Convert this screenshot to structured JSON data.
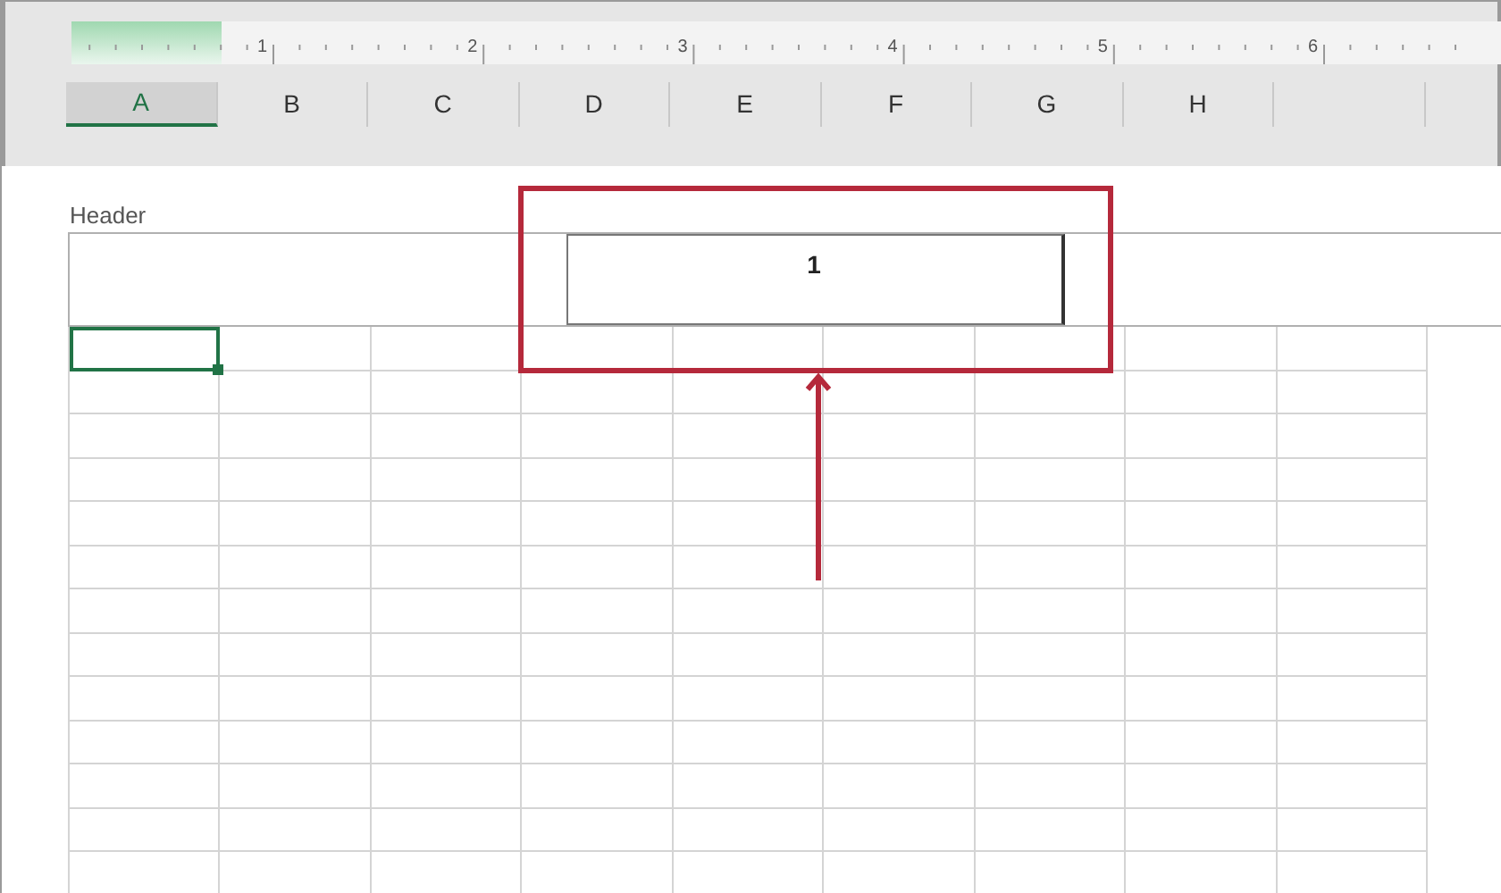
{
  "ruler": {
    "numbers": [
      "1",
      "2",
      "3",
      "4",
      "5",
      "6"
    ]
  },
  "columns": [
    {
      "label": "A",
      "selected": true
    },
    {
      "label": "B",
      "selected": false
    },
    {
      "label": "C",
      "selected": false
    },
    {
      "label": "D",
      "selected": false
    },
    {
      "label": "E",
      "selected": false
    },
    {
      "label": "F",
      "selected": false
    },
    {
      "label": "G",
      "selected": false
    },
    {
      "label": "H",
      "selected": false
    }
  ],
  "header": {
    "label": "Header",
    "center_value": "1"
  }
}
